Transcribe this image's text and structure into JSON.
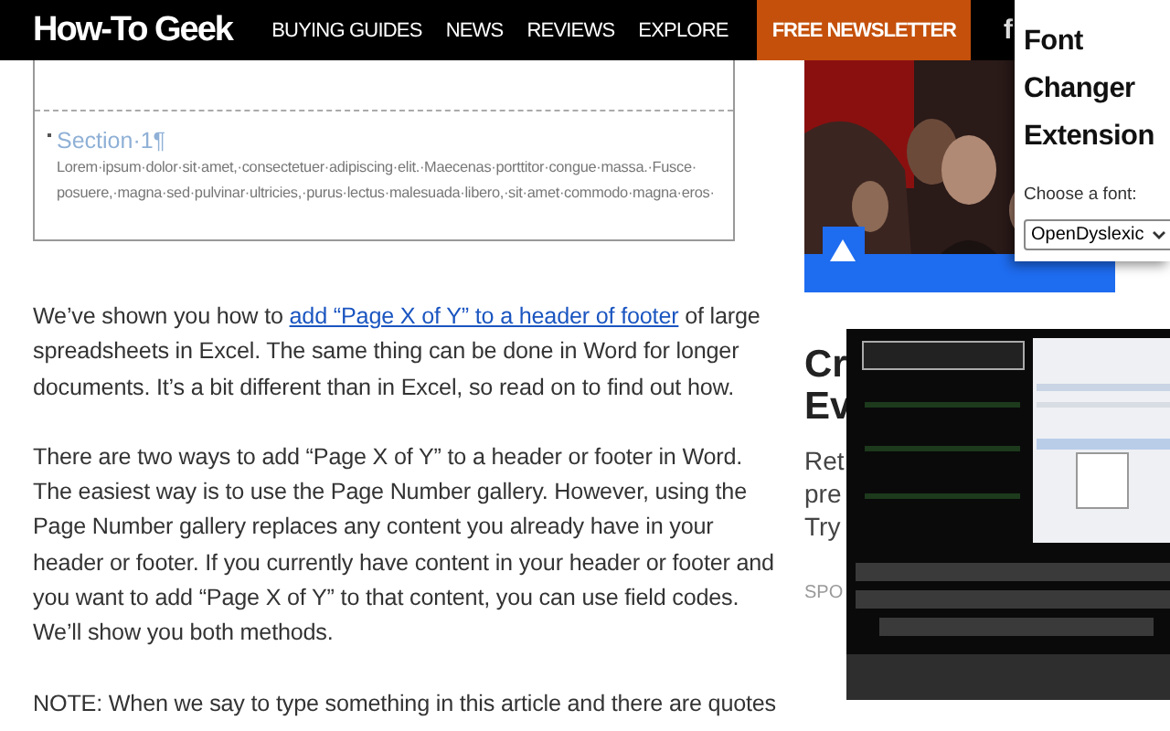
{
  "header": {
    "logo": "How-To Geek",
    "nav": [
      "BUYING GUIDES",
      "NEWS",
      "REVIEWS",
      "EXPLORE"
    ],
    "newsletter": "FREE NEWSLETTER",
    "social": "f"
  },
  "document": {
    "section_title": "Section·1¶",
    "body_lines": [
      "Lorem·ipsum·dolor·sit·amet,·consectetuer·adipiscing·elit.·Maecenas·porttitor·congue·massa.·Fusce·",
      "posuere,·magna·sed·pulvinar·ultricies,·purus·lectus·malesuada·libero,·sit·amet·commodo·magna·eros·"
    ]
  },
  "article": {
    "paragraphs": [
      {
        "before": "We’ve shown you how to ",
        "link": "add “Page X of Y” to a header of footer",
        "after": " of large spreadsheets in Excel. The same thing can be done in Word for longer documents. It’s a bit different than in Excel, so read on to find out how."
      },
      {
        "before": "There are two ways to add “Page X of Y” to a header or footer in Word. The easiest way is to use the Page Number gallery. However, using the Page Number gallery replaces any content you already have in your header or footer. If you currently have content in your header or footer and you want to add “Page X of Y” to that content, you can use field codes. We’ll show you both methods."
      },
      {
        "before": "NOTE: When we say to type something in this article and there are quotes"
      }
    ]
  },
  "sidebar": {
    "heading_lines": [
      "Cr",
      "Ev"
    ],
    "excerpt_lines": [
      "Ret",
      "pre",
      "Try"
    ],
    "label": "SPO"
  },
  "popup": {
    "title": "Font Changer Extension",
    "label": "Choose a font:",
    "font": "OpenDyslexic"
  }
}
